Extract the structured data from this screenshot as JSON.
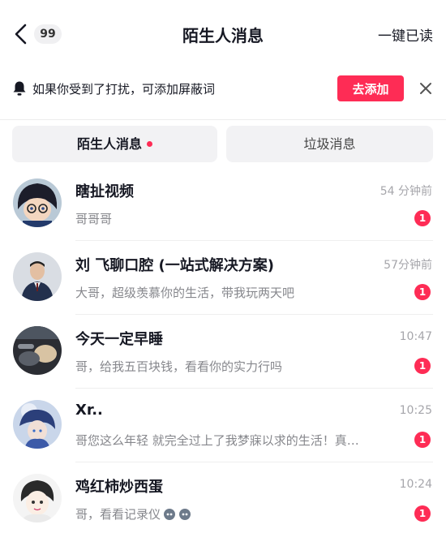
{
  "header": {
    "back_icon": "chevron-left-icon",
    "unread_count": "99",
    "title": "陌生人消息",
    "mark_all_read": "一键已读"
  },
  "notice": {
    "icon": "bell-icon",
    "text": "如果你受到了打扰，可添加屏蔽词",
    "add_button": "去添加",
    "close_icon": "close-icon"
  },
  "tabs": [
    {
      "label": "陌生人消息",
      "active": true,
      "has_dot": true
    },
    {
      "label": "垃圾消息",
      "active": false,
      "has_dot": false
    }
  ],
  "colors": {
    "accent": "#fe2c55",
    "text": "#161823",
    "muted": "#86878c",
    "time": "#a6a6ab",
    "tab_bg": "#f2f2f4"
  },
  "messages": [
    {
      "name": "瞎扯视频",
      "time": "54 分钟前",
      "preview": "哥哥哥",
      "unread": "1"
    },
    {
      "name": "刘 飞聊口腔 (一站式解决方案)",
      "time": "57分钟前",
      "preview": "大哥，超级羡慕你的生活，带我玩两天吧",
      "unread": "1"
    },
    {
      "name": "今天一定早睡",
      "time": "10:47",
      "preview": "哥，给我五百块钱，看看你的实力行吗",
      "unread": "1"
    },
    {
      "name": "Xr..",
      "time": "10:25",
      "preview": "哥您这么年轻 就完全过上了我梦寐以求的生活！真…",
      "unread": "1"
    },
    {
      "name": "鸡红柿炒西蛋",
      "time": "10:24",
      "preview": "哥，看看记录仪",
      "unread": "1"
    }
  ]
}
